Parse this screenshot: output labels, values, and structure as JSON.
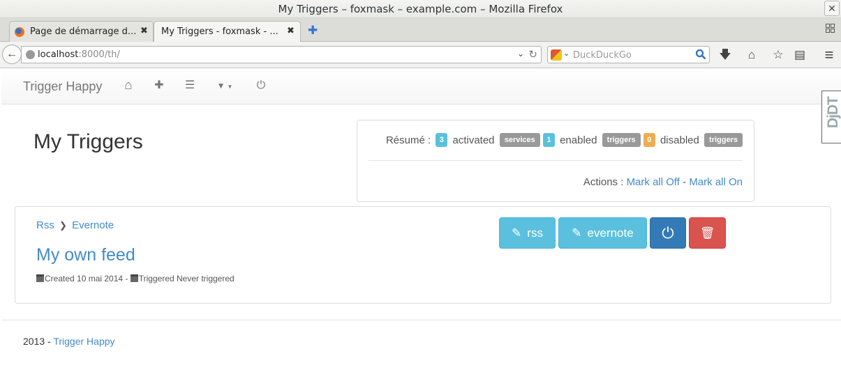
{
  "window": {
    "title": "My Triggers – foxmask – example.com – Mozilla Firefox",
    "close_glyph": "✕"
  },
  "tabs": [
    {
      "label": "Page de démarrage d...",
      "close_glyph": "✖"
    },
    {
      "label": "My Triggers - foxmask - ...",
      "close_glyph": "✖"
    }
  ],
  "newtab_glyph": "✚",
  "urlbar": {
    "host": "localhost",
    "rest": ":8000/th/",
    "dropdown_glyph": "⌄",
    "reload_glyph": "↻"
  },
  "searchbar": {
    "placeholder": "DuckDuckGo",
    "engine_dropdown_glyph": "⌄"
  },
  "back_glyph": "←",
  "toolbar_icons": [
    "download-icon",
    "home-icon",
    "bookmark-star-icon",
    "reading-list-icon",
    "menu-icon"
  ],
  "toolbar_glyphs": {
    "download": "🡇",
    "home": "⌂",
    "bookmark": "☆",
    "reading": "▤",
    "menu": "≡"
  },
  "app": {
    "brand": "Trigger Happy",
    "nav_glyphs": {
      "home": "⌂",
      "add": "✚",
      "list": "☰",
      "filter": "▼",
      "logout": "⏻"
    },
    "ddt_text": "DjDT"
  },
  "page_title": "My Triggers",
  "summary": {
    "resume_label": "Résumé :",
    "activated_count": "3",
    "activated_label": "activated",
    "services_tag": "services",
    "enabled_count": "1",
    "enabled_label": "enabled",
    "triggers_tag_1": "triggers",
    "disabled_count": "0",
    "disabled_label": "disabled",
    "triggers_tag_2": "triggers",
    "actions_label": "Actions :",
    "mark_all_off": "Mark all Off",
    "separator": "-",
    "mark_all_on": "Mark all On"
  },
  "trigger": {
    "provider": "Rss",
    "consumer": "Evernote",
    "chevron": "❯",
    "title": "My own feed",
    "created_label": "Created 10 mai 2014 -",
    "triggered_label": "Triggered Never triggered",
    "buttons": {
      "edit_provider": "rss",
      "edit_consumer": "evernote",
      "pencil": "✎",
      "power": "⏻",
      "trash": "🗑"
    }
  },
  "footer": {
    "year": "2013 -",
    "link": "Trigger Happy"
  }
}
